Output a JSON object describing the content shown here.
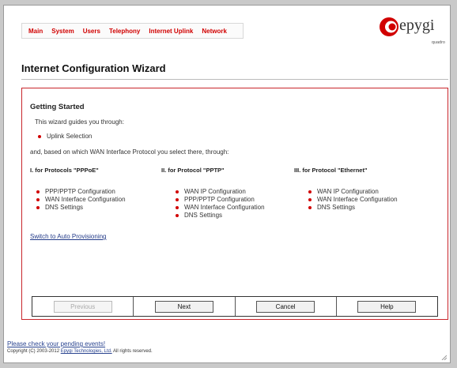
{
  "nav": [
    "Main",
    "System",
    "Users",
    "Telephony",
    "Internet Uplink",
    "Network"
  ],
  "logo": {
    "name": "epygi",
    "sub": "quadro",
    "brand_color": "#d10000"
  },
  "page_title": "Internet Configuration Wizard",
  "panel": {
    "heading": "Getting Started",
    "intro": "This wizard guides you through:",
    "first_steps": [
      "Uplink Selection"
    ],
    "then_text": "and, based on which WAN Interface Protocol you select there, through:",
    "columns": [
      {
        "title": "I. for Protocols \"PPPoE\"",
        "items": [
          "PPP/PPTP Configuration",
          "WAN Interface Configuration",
          "DNS Settings"
        ]
      },
      {
        "title": "II. for Protocol \"PPTP\"",
        "items": [
          "WAN IP Configuration",
          "PPP/PPTP Configuration",
          "WAN Interface Configuration",
          "DNS Settings"
        ]
      },
      {
        "title": "III. for Protocol \"Ethernet\"",
        "items": [
          "WAN IP Configuration",
          "WAN Interface Configuration",
          "DNS Settings"
        ]
      }
    ],
    "auto_link": "Switch to Auto Provisioning",
    "buttons": {
      "previous": "Previous",
      "next": "Next",
      "cancel": "Cancel",
      "help": "Help"
    }
  },
  "footer": {
    "events_link": "Please check your pending events!",
    "copyright_prefix": "Copyright (C) 2003-2012",
    "company": "Epygi Technologies, Ltd.",
    "copyright_suffix": "All rights reserved."
  }
}
